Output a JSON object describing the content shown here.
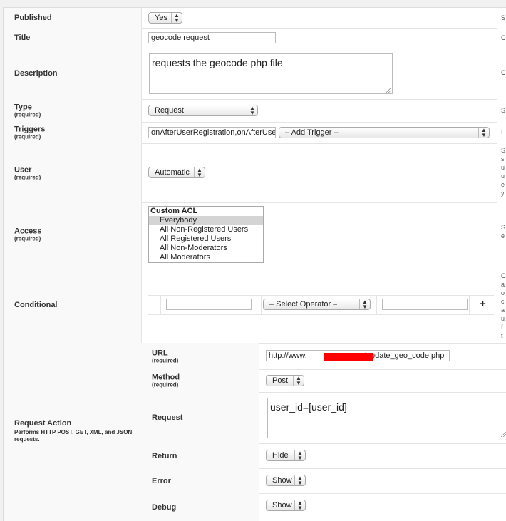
{
  "published": {
    "label": "Published",
    "value": "Yes",
    "desc": "S"
  },
  "title": {
    "label": "Title",
    "value": "geocode request",
    "desc": "C"
  },
  "description": {
    "label": "Description",
    "value": "requests the geocode php file",
    "desc": "C"
  },
  "type": {
    "label": "Type",
    "required": "(required)",
    "value": "Request",
    "desc": "S"
  },
  "triggers": {
    "label": "Triggers",
    "required": "(required)",
    "value": "onAfterUserRegistration,onAfterUser",
    "select": "– Add Trigger –",
    "desc": "I"
  },
  "user": {
    "label": "User",
    "required": "(required)",
    "value": "Automatic",
    "desc": [
      "S",
      "s",
      "u",
      "u",
      "e",
      "y"
    ]
  },
  "access": {
    "label": "Access",
    "required": "(required)",
    "group": "Custom ACL",
    "options": [
      "Everybody",
      "All Non-Registered Users",
      "All Registered Users",
      "All Non-Moderators",
      "All Moderators"
    ],
    "selected": "Everybody",
    "desc": [
      "S",
      "e"
    ]
  },
  "conditional": {
    "label": "Conditional",
    "operator": "– Select Operator –",
    "add": "+",
    "desc": [
      "C",
      "a",
      "o",
      "c",
      "a",
      "u",
      "f",
      "t"
    ]
  },
  "request_action": {
    "label": "Request Action",
    "sub": "Performs HTTP POST, GET, XML, and JSON requests.",
    "url": {
      "label": "URL",
      "required": "(required)",
      "prefix": "http://www.",
      "suffix": "/update_geo_code.php"
    },
    "method": {
      "label": "Method",
      "required": "(required)",
      "value": "Post"
    },
    "request": {
      "label": "Request",
      "value": "user_id=[user_id]"
    },
    "return": {
      "label": "Return",
      "value": "Hide"
    },
    "error": {
      "label": "Error",
      "value": "Show"
    },
    "debug": {
      "label": "Debug",
      "value": "Show"
    }
  },
  "colors": {
    "label_bg": "#f9f9f9",
    "border": "#e4e4e4",
    "redaction": "#ff0000"
  }
}
